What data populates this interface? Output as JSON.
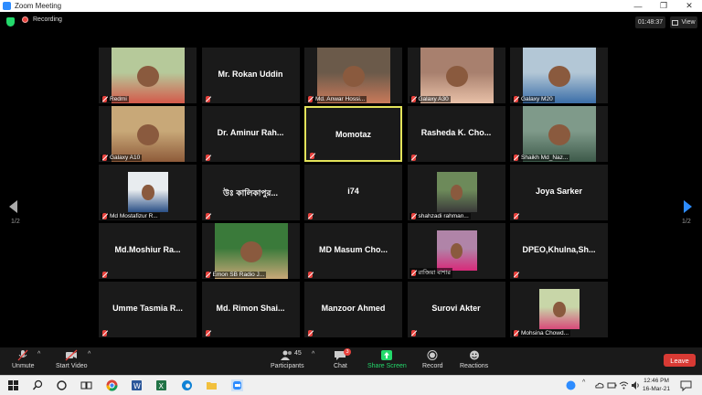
{
  "window": {
    "title": "Zoom Meeting",
    "minimize": "—",
    "maximize": "❐",
    "close": "✕"
  },
  "topbar": {
    "recording": "Recording",
    "timer": "01:48:37",
    "view": "View"
  },
  "pager": {
    "left": "1/2",
    "right": "1/2"
  },
  "tiles": [
    {
      "name": "",
      "label": "Redmi",
      "video": true
    },
    {
      "name": "Mr. Rokan Uddin",
      "label": "",
      "video": false
    },
    {
      "name": "",
      "label": "Md. Anwar Hossi...",
      "video": true
    },
    {
      "name": "",
      "label": "Galaxy A30",
      "video": true
    },
    {
      "name": "",
      "label": "Galaxy M20",
      "video": true
    },
    {
      "name": "",
      "label": "Galaxy A10",
      "video": true
    },
    {
      "name": "Dr. Aminur Rah...",
      "label": "",
      "video": false
    },
    {
      "name": "Momotaz",
      "label": "",
      "video": false,
      "active": true
    },
    {
      "name": "Rasheda K. Cho...",
      "label": "",
      "video": false
    },
    {
      "name": "",
      "label": "Shaikh Md_Naz...",
      "video": true
    },
    {
      "name": "",
      "label": "Md Mostafizur R...",
      "video": true
    },
    {
      "name": "উঃ কালিকাপুর...",
      "label": "",
      "video": false
    },
    {
      "name": "i74",
      "label": "",
      "video": false
    },
    {
      "name": "",
      "label": "shahzadi rahman...",
      "video": true
    },
    {
      "name": "Joya Sarker",
      "label": "",
      "video": false
    },
    {
      "name": "Md.Moshiur Ra...",
      "label": "",
      "video": false
    },
    {
      "name": "",
      "label": "Emon SB Radio J...",
      "video": true
    },
    {
      "name": "MD Masum Cho...",
      "label": "",
      "video": false
    },
    {
      "name": "",
      "label": "রাজিয়া বাশার",
      "video": true
    },
    {
      "name": "DPEO,Khulna,Sh...",
      "label": "",
      "video": false
    },
    {
      "name": "Umme Tasmia R...",
      "label": "",
      "video": false
    },
    {
      "name": "Md. Rimon Shai...",
      "label": "",
      "video": false
    },
    {
      "name": "Manzoor Ahmed",
      "label": "",
      "video": false
    },
    {
      "name": "Surovi Akter",
      "label": "",
      "video": false
    },
    {
      "name": "",
      "label": "Mohsina Chowd...",
      "video": true
    }
  ],
  "toolbar": {
    "unmute": "Unmute",
    "start_video": "Start Video",
    "participants": "Participants",
    "participants_count": "45",
    "chat": "Chat",
    "chat_badge": "3",
    "share": "Share Screen",
    "record": "Record",
    "reactions": "Reactions",
    "leave": "Leave"
  },
  "taskbar": {
    "time": "12:46 PM",
    "date": "16-Mar-21",
    "lang": "ENG"
  },
  "colors": {
    "accent": "#2d8cff",
    "share_green": "#23d96b",
    "leave_red": "#d83a34",
    "active_border": "#e3e35a"
  }
}
